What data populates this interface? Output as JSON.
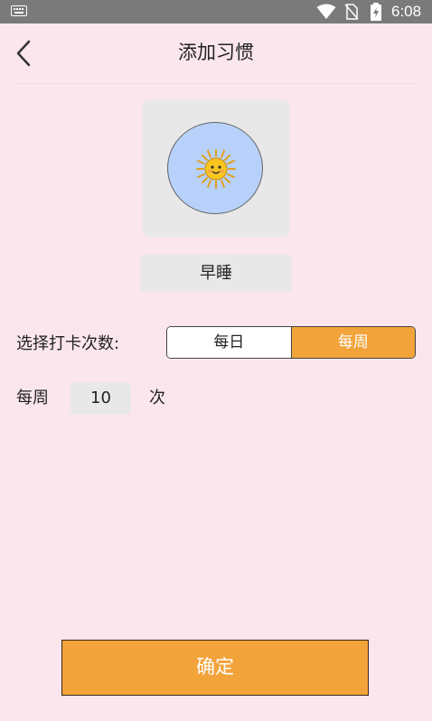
{
  "status_bar": {
    "time": "6:08",
    "icons": [
      "keyboard-icon",
      "wifi-icon",
      "no-sim-icon",
      "battery-charging-icon"
    ]
  },
  "header": {
    "back_icon": "chevron-left-icon",
    "title": "添加习惯"
  },
  "habit": {
    "icon": "sun-icon",
    "icon_background": "#b7d1fb",
    "name": "早睡"
  },
  "frequency": {
    "label": "选择打卡次数:",
    "options": [
      "每日",
      "每周"
    ],
    "selected": "每周"
  },
  "count": {
    "prefix": "每周",
    "value": "10",
    "suffix": "次"
  },
  "actions": {
    "confirm_label": "确定"
  },
  "colors": {
    "background": "#fbe6ee",
    "accent": "#f2a33a",
    "field": "#e8e8e8",
    "status_bar": "#7a7a7a"
  }
}
